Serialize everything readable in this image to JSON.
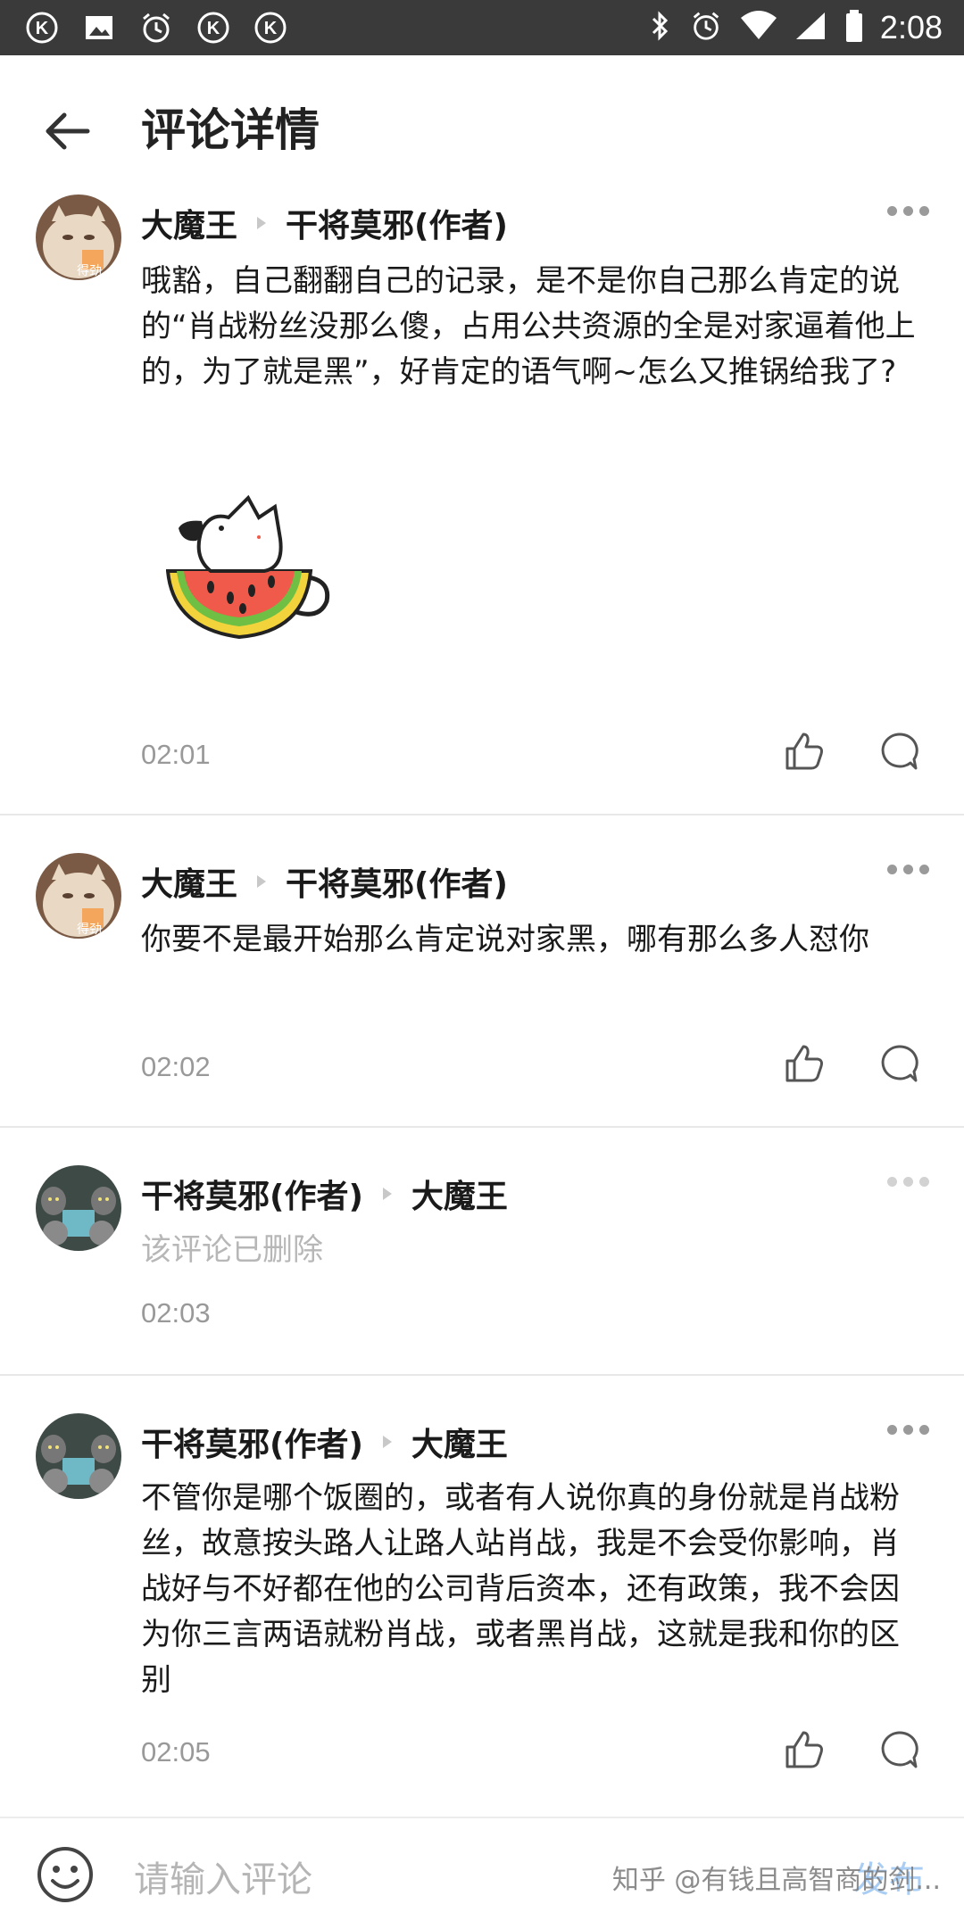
{
  "status_bar": {
    "time": "2:08",
    "left_icons": [
      "k-badge-icon",
      "image-icon",
      "alarm-icon",
      "k-badge-icon",
      "k-badge-icon"
    ],
    "right_icons": [
      "bluetooth-icon",
      "alarm-icon",
      "wifi-icon",
      "signal-icon",
      "battery-icon"
    ]
  },
  "header": {
    "title": "评论详情"
  },
  "comments": [
    {
      "author": "大魔王",
      "reply_to": "干将莫邪(作者)",
      "text": "哦豁，自己翻翻自己的记录，是不是你自己那么肯定的说的“肖战粉丝没那么傻，占用公共资源的全是对家逼着他上的，为了就是黑”，好肯定的语气啊~怎么又推锅给我了?",
      "has_sticker": true,
      "time": "02:01"
    },
    {
      "author": "大魔王",
      "reply_to": "干将莫邪(作者)",
      "text": "你要不是最开始那么肯定说对家黑，哪有那么多人怼你",
      "time": "02:02"
    },
    {
      "author": "干将莫邪(作者)",
      "reply_to": "大魔王",
      "text": "该评论已删除",
      "deleted": true,
      "time": "02:03"
    },
    {
      "author": "干将莫邪(作者)",
      "reply_to": "大魔王",
      "text": "不管你是哪个饭圈的，或者有人说你真的身份就是肖战粉丝，故意按头路人让路人站肖战，我是不会受你影响，肖战好与不好都在他的公司背后资本，还有政策，我不会因为你三言两语就粉肖战，或者黑肖战，这就是我和你的区别",
      "time": "02:05"
    }
  ],
  "input_bar": {
    "placeholder": "请输入评论",
    "send_label": "发布",
    "watermark": "知乎 @有钱且高智商的剑..."
  },
  "colors": {
    "accent": "#a9cdf3",
    "muted": "#999999",
    "deleted": "#b7b7b7"
  }
}
